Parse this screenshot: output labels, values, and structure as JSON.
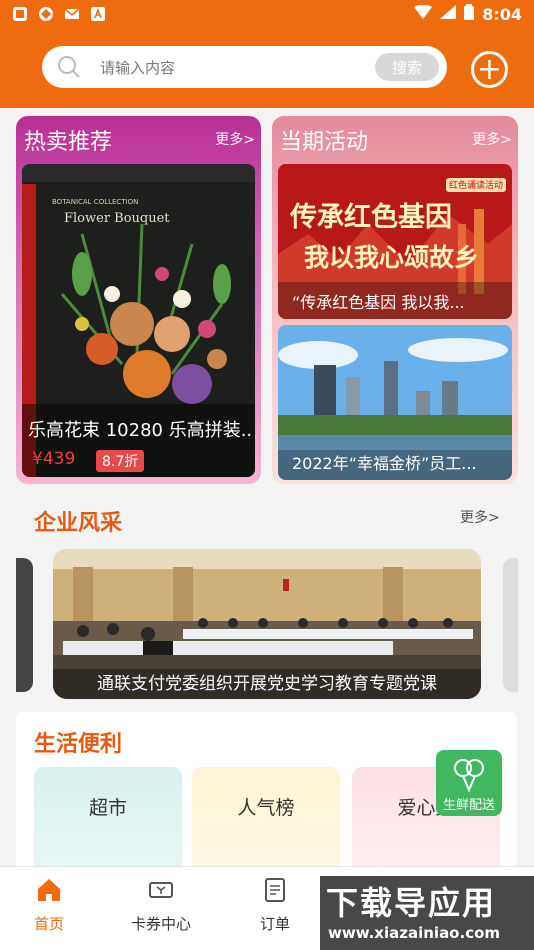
{
  "status_bar": {
    "time": "8:04"
  },
  "search": {
    "placeholder": "请输入内容",
    "button_label": "搜索"
  },
  "hot": {
    "title": "热卖推荐",
    "more": "更多>",
    "product": {
      "name": "乐高花束 10280 乐高拼装...",
      "price": "¥439",
      "discount": "8.7折",
      "box_brand": "Flower Bouquet",
      "box_collection": "BOTANICAL COLLECTION"
    }
  },
  "activity": {
    "title": "当期活动",
    "more": "更多>",
    "items": [
      {
        "caption": "“传承红色基因 我以我...",
        "banner_main": "传承红色基因",
        "banner_sub": "我以我心颂故乡",
        "banner_badge": "红色诵读活动"
      },
      {
        "caption": "2022年“幸福金桥”员工..."
      }
    ]
  },
  "enterprise": {
    "title": "企业风采",
    "more": "更多>",
    "caption": "通联支付党委组织开展党史学习教育专题党课"
  },
  "life": {
    "title": "生活便利",
    "tiles": [
      "超市",
      "人气榜",
      "爱心集"
    ]
  },
  "fresh_button": "生鲜配送",
  "nav": {
    "items": [
      {
        "label": "首页",
        "icon": "home-icon"
      },
      {
        "label": "卡券中心",
        "icon": "ticket-icon"
      },
      {
        "label": "订单",
        "icon": "order-icon"
      }
    ]
  },
  "watermark": {
    "main": "下载导应用",
    "url": "www.xiazainiao.com"
  },
  "colors": {
    "brand": "#ef6c0e",
    "title_orange": "#e35b13",
    "fresh_green": "#3fb860"
  }
}
